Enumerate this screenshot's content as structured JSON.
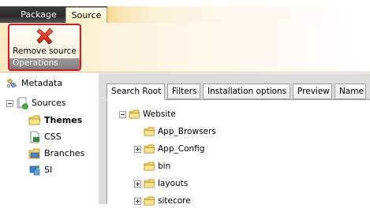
{
  "ribbon_tabs": {
    "package": "Package",
    "source": "Source"
  },
  "operations_group": {
    "remove_source_label": "Remove source",
    "caption": "Operations"
  },
  "left_tree": {
    "metadata": "Metadata",
    "sources": "Sources",
    "children": [
      "Themes",
      "CSS",
      "Branches",
      "SI"
    ]
  },
  "inner_tabs": [
    "Search Root",
    "Filters",
    "Installation options",
    "Preview",
    "Name"
  ],
  "folder_tree": {
    "root": "Website",
    "children": [
      "App_Browsers",
      "App_Config",
      "bin",
      "layouts",
      "sitecore"
    ]
  },
  "colors": {
    "highlight_border": "#e0141b",
    "tab_bar": "#2b2b2b",
    "group_caption": "#8a8a8a"
  }
}
